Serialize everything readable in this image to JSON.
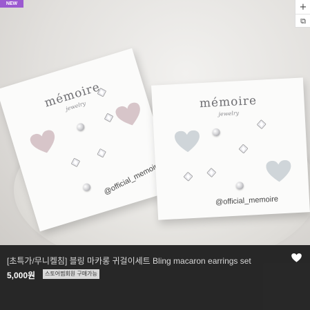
{
  "badge": {
    "new": "NEW"
  },
  "actions": {
    "zoom_icon": "+",
    "copy_icon": "⧉"
  },
  "product": {
    "brand": "mémoire",
    "brand_sub": "jewelry",
    "instagram": "@official_memoire",
    "title": "[초특가/무니켈침] 블링 마카롱 귀걸이세트 Bling macaron earrings set",
    "price": "5,000원",
    "member_badge": "스토어찜회원 구매가능",
    "colors": {
      "left_heart": "#d7c5c9",
      "right_heart": "#cfd5d9",
      "new_badge": "#9b59d0"
    }
  }
}
